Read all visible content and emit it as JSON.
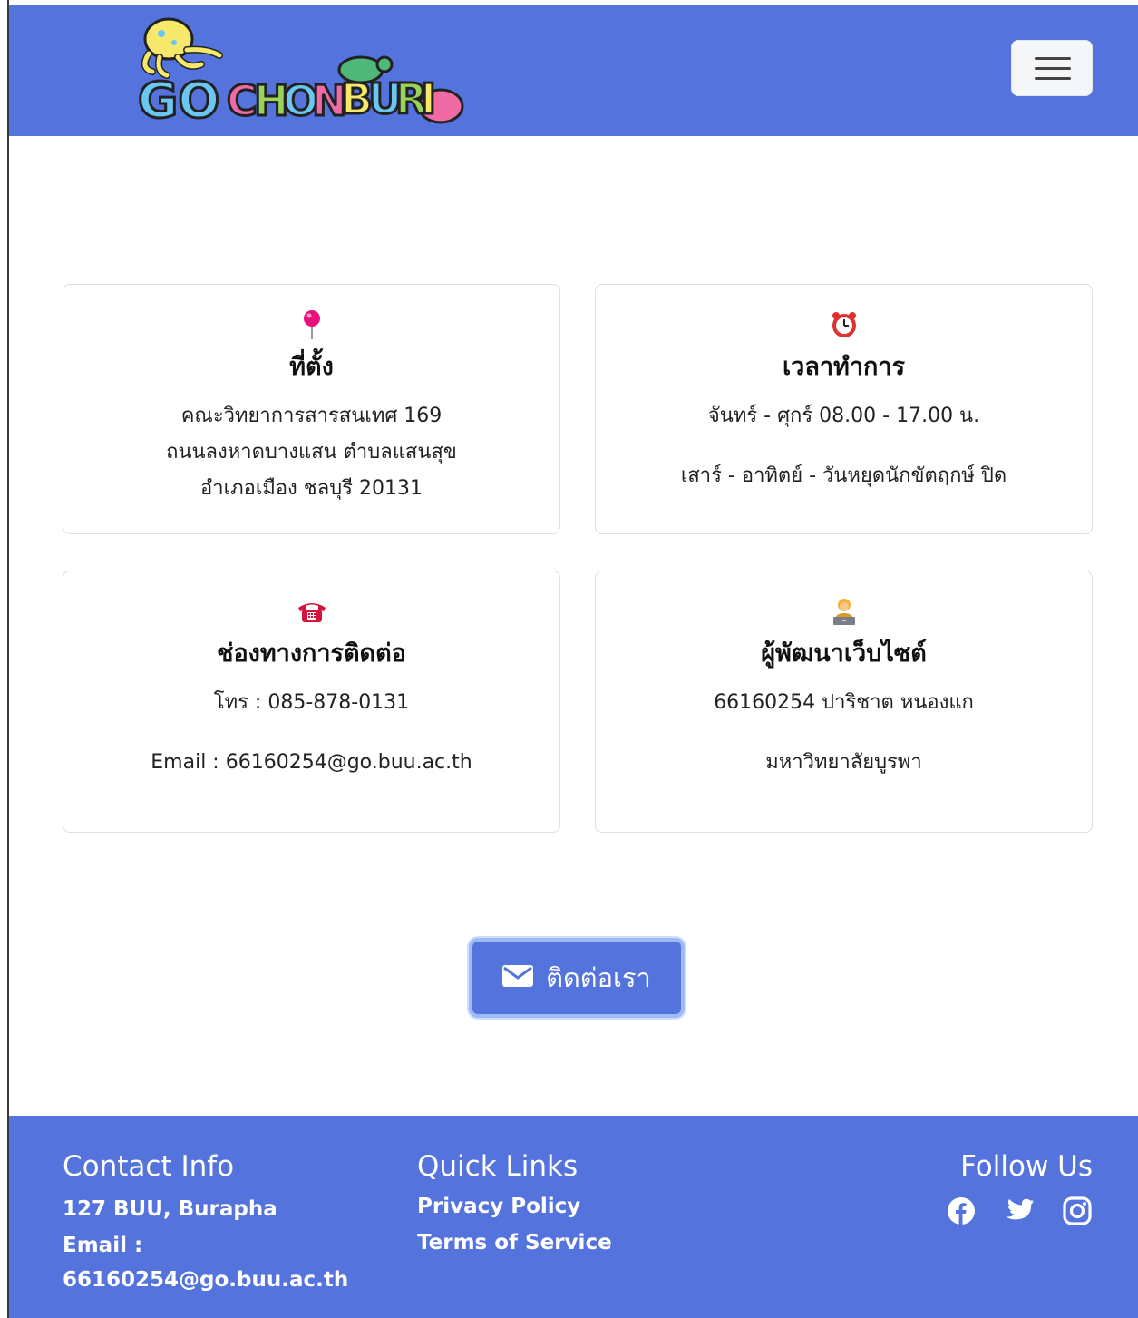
{
  "brand": {
    "logo_text": "GO CHONBURI",
    "accent": "#5473dc"
  },
  "navbar": {
    "toggler_icon": "hamburger-menu-icon"
  },
  "cards": {
    "location": {
      "icon": "pin-icon",
      "title": "ที่ตั้ง",
      "lines": [
        "คณะวิทยาการสารสนเทศ 169",
        "ถนนลงหาดบางแสน ตำบลแสนสุข",
        "อำเภอเมือง ชลบุรี 20131"
      ]
    },
    "hours": {
      "icon": "alarm-clock-icon",
      "title": "เวลาทำการ",
      "line1": "จันทร์ - ศุกร์ 08.00 - 17.00 น.",
      "line2": "เสาร์ - อาทิตย์ - วันหยุดนักขัตฤกษ์ ปิด"
    },
    "contact": {
      "icon": "telephone-icon",
      "title": "ช่องทางการติดต่อ",
      "line1": "โทร : 085-878-0131",
      "line2": "Email : 66160254@go.buu.ac.th"
    },
    "developer": {
      "icon": "technologist-icon",
      "title": "ผู้พัฒนาเว็บไซต์",
      "line1": "66160254 ปาริชาต หนองแก",
      "line2": "มหาวิทยาลัยบูรพา"
    }
  },
  "contact_button": {
    "icon": "envelope-icon",
    "label": "ติดต่อเรา"
  },
  "footer": {
    "contact": {
      "heading": "Contact Info",
      "address": "127 BUU, Burapha",
      "email_label": "Email :",
      "email": "66160254@go.buu.ac.th"
    },
    "links": {
      "heading": "Quick Links",
      "items": [
        "Privacy Policy",
        "Terms of Service"
      ]
    },
    "follow": {
      "heading": "Follow Us",
      "icons": [
        "facebook-icon",
        "twitter-icon",
        "instagram-icon"
      ]
    }
  }
}
